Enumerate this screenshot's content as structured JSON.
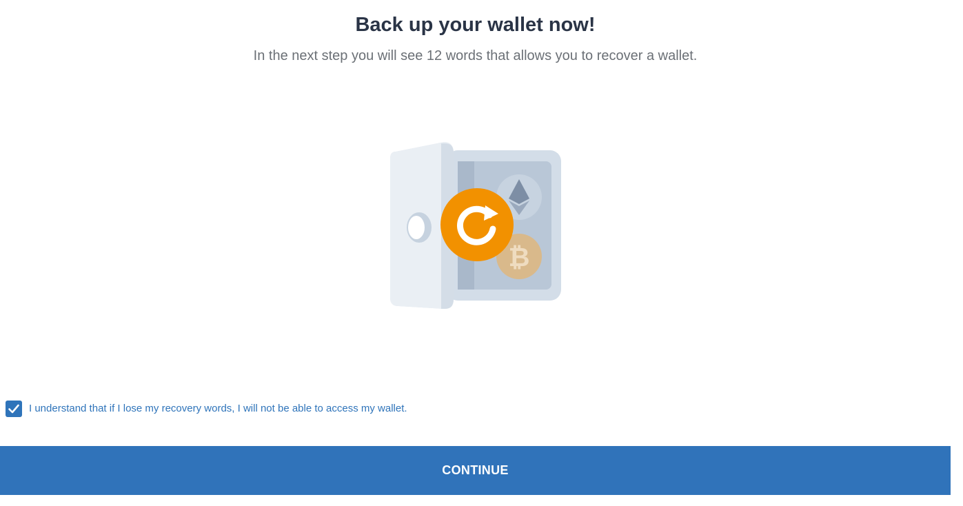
{
  "header": {
    "title": "Back up your wallet now!",
    "subtitle": "In the next step you will see 12 words that allows you to recover a wallet."
  },
  "illustration": {
    "icon": "safe-with-crypto-illustration",
    "badges": [
      "refresh-icon",
      "ethereum-icon",
      "bitcoin-icon"
    ],
    "colors": {
      "safe_body": "#d3dde8",
      "safe_door": "#e9eef3",
      "accent_orange": "#f29100",
      "coin_bitcoin": "#d9b98b"
    }
  },
  "acknowledgement": {
    "checked": true,
    "label": "I understand that if I lose my recovery words, I will not be able to access my wallet."
  },
  "actions": {
    "continue_label": "CONTINUE"
  },
  "colors": {
    "primary": "#3073ba",
    "title_text": "#2a3446",
    "subtitle_text": "#6b7076"
  }
}
